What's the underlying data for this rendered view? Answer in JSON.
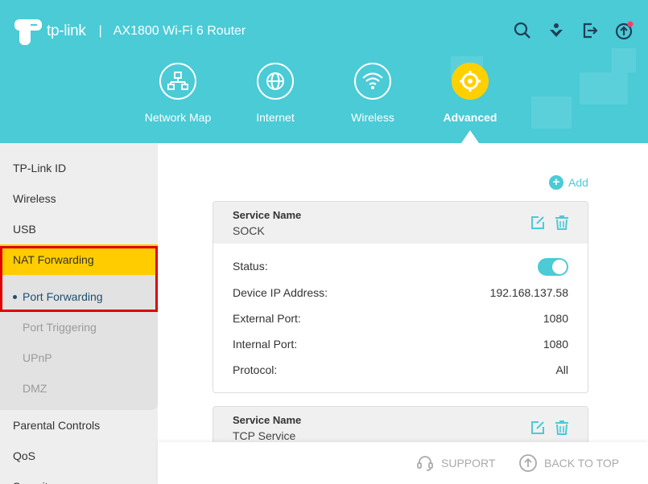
{
  "header": {
    "logo_text": "tp-link",
    "separator": "|",
    "product": "AX1800 Wi-Fi 6 Router",
    "icons": [
      "search-icon",
      "account-icon",
      "logout-icon",
      "firmware-update-icon"
    ]
  },
  "nav": {
    "items": [
      {
        "label": "Network Map",
        "icon": "network-map-icon"
      },
      {
        "label": "Internet",
        "icon": "globe-icon"
      },
      {
        "label": "Wireless",
        "icon": "wifi-icon"
      },
      {
        "label": "Advanced",
        "icon": "gear-icon",
        "active": true
      }
    ]
  },
  "sidebar": {
    "items": [
      {
        "label": "TP-Link ID"
      },
      {
        "label": "Wireless"
      },
      {
        "label": "USB"
      },
      {
        "label": "NAT Forwarding",
        "active": true
      },
      {
        "label": "Parental Controls"
      },
      {
        "label": "QoS"
      },
      {
        "label": "Security"
      }
    ],
    "sub_items": [
      {
        "label": "Port Forwarding",
        "current": true
      },
      {
        "label": "Port Triggering"
      },
      {
        "label": "UPnP"
      },
      {
        "label": "DMZ"
      }
    ]
  },
  "main": {
    "add_label": "Add",
    "card1": {
      "title": "Service Name",
      "name": "SOCK",
      "status_label": "Status:",
      "status_on": true,
      "device_ip_label": "Device IP Address:",
      "device_ip": "192.168.137.58",
      "external_port_label": "External Port:",
      "external_port": "1080",
      "internal_port_label": "Internal Port:",
      "internal_port": "1080",
      "protocol_label": "Protocol:",
      "protocol": "All"
    },
    "card2": {
      "title": "Service Name",
      "name": "TCP Service"
    }
  },
  "footer": {
    "support": "SUPPORT",
    "back_to_top": "BACK TO TOP"
  },
  "colors": {
    "header_bg": "#4acbd6",
    "active_yellow": "#ffcc00",
    "highlight_red": "#e00000",
    "accent": "#4acbd6"
  }
}
